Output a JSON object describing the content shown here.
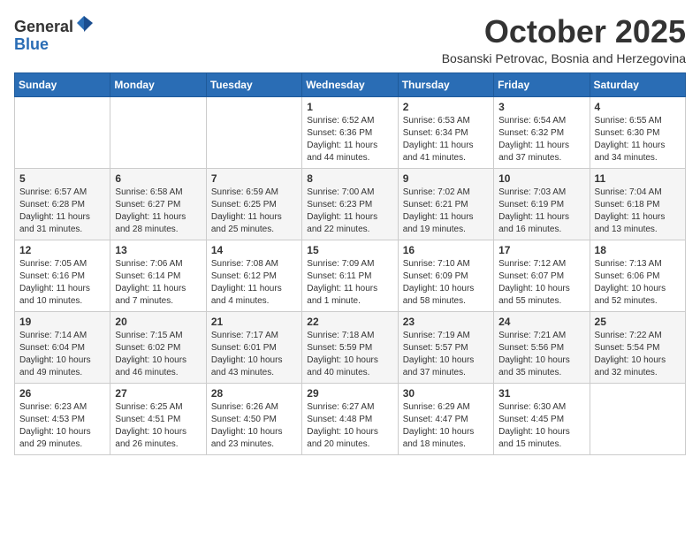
{
  "header": {
    "logo_general": "General",
    "logo_blue": "Blue",
    "month": "October 2025",
    "subtitle": "Bosanski Petrovac, Bosnia and Herzegovina"
  },
  "weekdays": [
    "Sunday",
    "Monday",
    "Tuesday",
    "Wednesday",
    "Thursday",
    "Friday",
    "Saturday"
  ],
  "weeks": [
    [
      {
        "day": "",
        "info": ""
      },
      {
        "day": "",
        "info": ""
      },
      {
        "day": "",
        "info": ""
      },
      {
        "day": "1",
        "info": "Sunrise: 6:52 AM\nSunset: 6:36 PM\nDaylight: 11 hours\nand 44 minutes."
      },
      {
        "day": "2",
        "info": "Sunrise: 6:53 AM\nSunset: 6:34 PM\nDaylight: 11 hours\nand 41 minutes."
      },
      {
        "day": "3",
        "info": "Sunrise: 6:54 AM\nSunset: 6:32 PM\nDaylight: 11 hours\nand 37 minutes."
      },
      {
        "day": "4",
        "info": "Sunrise: 6:55 AM\nSunset: 6:30 PM\nDaylight: 11 hours\nand 34 minutes."
      }
    ],
    [
      {
        "day": "5",
        "info": "Sunrise: 6:57 AM\nSunset: 6:28 PM\nDaylight: 11 hours\nand 31 minutes."
      },
      {
        "day": "6",
        "info": "Sunrise: 6:58 AM\nSunset: 6:27 PM\nDaylight: 11 hours\nand 28 minutes."
      },
      {
        "day": "7",
        "info": "Sunrise: 6:59 AM\nSunset: 6:25 PM\nDaylight: 11 hours\nand 25 minutes."
      },
      {
        "day": "8",
        "info": "Sunrise: 7:00 AM\nSunset: 6:23 PM\nDaylight: 11 hours\nand 22 minutes."
      },
      {
        "day": "9",
        "info": "Sunrise: 7:02 AM\nSunset: 6:21 PM\nDaylight: 11 hours\nand 19 minutes."
      },
      {
        "day": "10",
        "info": "Sunrise: 7:03 AM\nSunset: 6:19 PM\nDaylight: 11 hours\nand 16 minutes."
      },
      {
        "day": "11",
        "info": "Sunrise: 7:04 AM\nSunset: 6:18 PM\nDaylight: 11 hours\nand 13 minutes."
      }
    ],
    [
      {
        "day": "12",
        "info": "Sunrise: 7:05 AM\nSunset: 6:16 PM\nDaylight: 11 hours\nand 10 minutes."
      },
      {
        "day": "13",
        "info": "Sunrise: 7:06 AM\nSunset: 6:14 PM\nDaylight: 11 hours\nand 7 minutes."
      },
      {
        "day": "14",
        "info": "Sunrise: 7:08 AM\nSunset: 6:12 PM\nDaylight: 11 hours\nand 4 minutes."
      },
      {
        "day": "15",
        "info": "Sunrise: 7:09 AM\nSunset: 6:11 PM\nDaylight: 11 hours\nand 1 minute."
      },
      {
        "day": "16",
        "info": "Sunrise: 7:10 AM\nSunset: 6:09 PM\nDaylight: 10 hours\nand 58 minutes."
      },
      {
        "day": "17",
        "info": "Sunrise: 7:12 AM\nSunset: 6:07 PM\nDaylight: 10 hours\nand 55 minutes."
      },
      {
        "day": "18",
        "info": "Sunrise: 7:13 AM\nSunset: 6:06 PM\nDaylight: 10 hours\nand 52 minutes."
      }
    ],
    [
      {
        "day": "19",
        "info": "Sunrise: 7:14 AM\nSunset: 6:04 PM\nDaylight: 10 hours\nand 49 minutes."
      },
      {
        "day": "20",
        "info": "Sunrise: 7:15 AM\nSunset: 6:02 PM\nDaylight: 10 hours\nand 46 minutes."
      },
      {
        "day": "21",
        "info": "Sunrise: 7:17 AM\nSunset: 6:01 PM\nDaylight: 10 hours\nand 43 minutes."
      },
      {
        "day": "22",
        "info": "Sunrise: 7:18 AM\nSunset: 5:59 PM\nDaylight: 10 hours\nand 40 minutes."
      },
      {
        "day": "23",
        "info": "Sunrise: 7:19 AM\nSunset: 5:57 PM\nDaylight: 10 hours\nand 37 minutes."
      },
      {
        "day": "24",
        "info": "Sunrise: 7:21 AM\nSunset: 5:56 PM\nDaylight: 10 hours\nand 35 minutes."
      },
      {
        "day": "25",
        "info": "Sunrise: 7:22 AM\nSunset: 5:54 PM\nDaylight: 10 hours\nand 32 minutes."
      }
    ],
    [
      {
        "day": "26",
        "info": "Sunrise: 6:23 AM\nSunset: 4:53 PM\nDaylight: 10 hours\nand 29 minutes."
      },
      {
        "day": "27",
        "info": "Sunrise: 6:25 AM\nSunset: 4:51 PM\nDaylight: 10 hours\nand 26 minutes."
      },
      {
        "day": "28",
        "info": "Sunrise: 6:26 AM\nSunset: 4:50 PM\nDaylight: 10 hours\nand 23 minutes."
      },
      {
        "day": "29",
        "info": "Sunrise: 6:27 AM\nSunset: 4:48 PM\nDaylight: 10 hours\nand 20 minutes."
      },
      {
        "day": "30",
        "info": "Sunrise: 6:29 AM\nSunset: 4:47 PM\nDaylight: 10 hours\nand 18 minutes."
      },
      {
        "day": "31",
        "info": "Sunrise: 6:30 AM\nSunset: 4:45 PM\nDaylight: 10 hours\nand 15 minutes."
      },
      {
        "day": "",
        "info": ""
      }
    ]
  ]
}
